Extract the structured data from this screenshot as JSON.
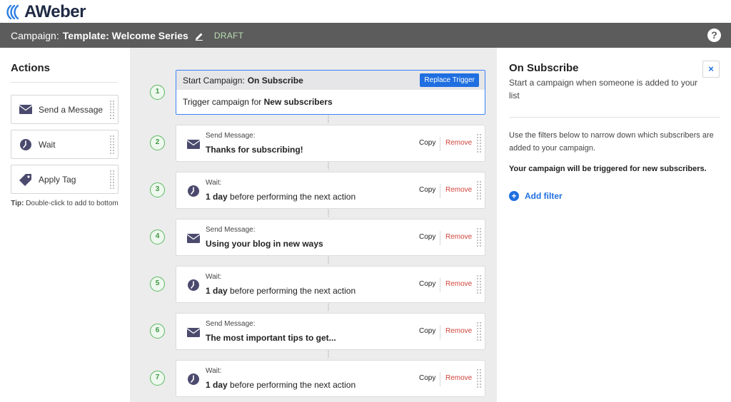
{
  "brand": {
    "logo_text": "AWeber"
  },
  "header": {
    "campaign_label": "Campaign:",
    "campaign_name": "Template: Welcome Series",
    "status": "DRAFT",
    "help_label": "?"
  },
  "actions": {
    "title": "Actions",
    "items": [
      {
        "label": "Send a Message",
        "icon": "envelope-icon"
      },
      {
        "label": "Wait",
        "icon": "clock-icon"
      },
      {
        "label": "Apply Tag",
        "icon": "tag-icon"
      }
    ],
    "tip_bold": "Tip:",
    "tip_text": " Double-click to add to bottom"
  },
  "trigger": {
    "step": "1",
    "head_label": "Start Campaign:",
    "head_value": "On Subscribe",
    "replace_label": "Replace Trigger",
    "body_label": "Trigger campaign for ",
    "body_value": "New subscribers"
  },
  "steps": [
    {
      "num": "2",
      "type": "message",
      "title": "Send Message:",
      "desc_bold": "Thanks for subscribing!",
      "desc_rest": "",
      "copy": "Copy",
      "remove": "Remove"
    },
    {
      "num": "3",
      "type": "wait",
      "title": "Wait:",
      "desc_bold": "1 day",
      "desc_rest": " before performing the next action",
      "copy": "Copy",
      "remove": "Remove"
    },
    {
      "num": "4",
      "type": "message",
      "title": "Send Message:",
      "desc_bold": "Using your blog in new ways",
      "desc_rest": "",
      "copy": "Copy",
      "remove": "Remove"
    },
    {
      "num": "5",
      "type": "wait",
      "title": "Wait:",
      "desc_bold": "1 day",
      "desc_rest": " before performing the next action",
      "copy": "Copy",
      "remove": "Remove"
    },
    {
      "num": "6",
      "type": "message",
      "title": "Send Message:",
      "desc_bold": "The most important tips to get...",
      "desc_rest": "",
      "copy": "Copy",
      "remove": "Remove"
    },
    {
      "num": "7",
      "type": "wait",
      "title": "Wait:",
      "desc_bold": "1 day",
      "desc_rest": " before performing the next action",
      "copy": "Copy",
      "remove": "Remove"
    }
  ],
  "panel": {
    "title": "On Subscribe",
    "subtitle": "Start a campaign when someone is added to your list",
    "close_label": "×",
    "filter_text": "Use the filters below to narrow down which subscribers are added to your campaign.",
    "trigger_note": "Your campaign will be triggered for new subscribers.",
    "add_filter_label": "Add filter"
  },
  "colors": {
    "header_bg": "#5c5c5c",
    "accent_blue": "#1f6fe0",
    "step_green": "#5bb861",
    "remove_red": "#d0433b",
    "canvas_bg": "#ececec"
  }
}
